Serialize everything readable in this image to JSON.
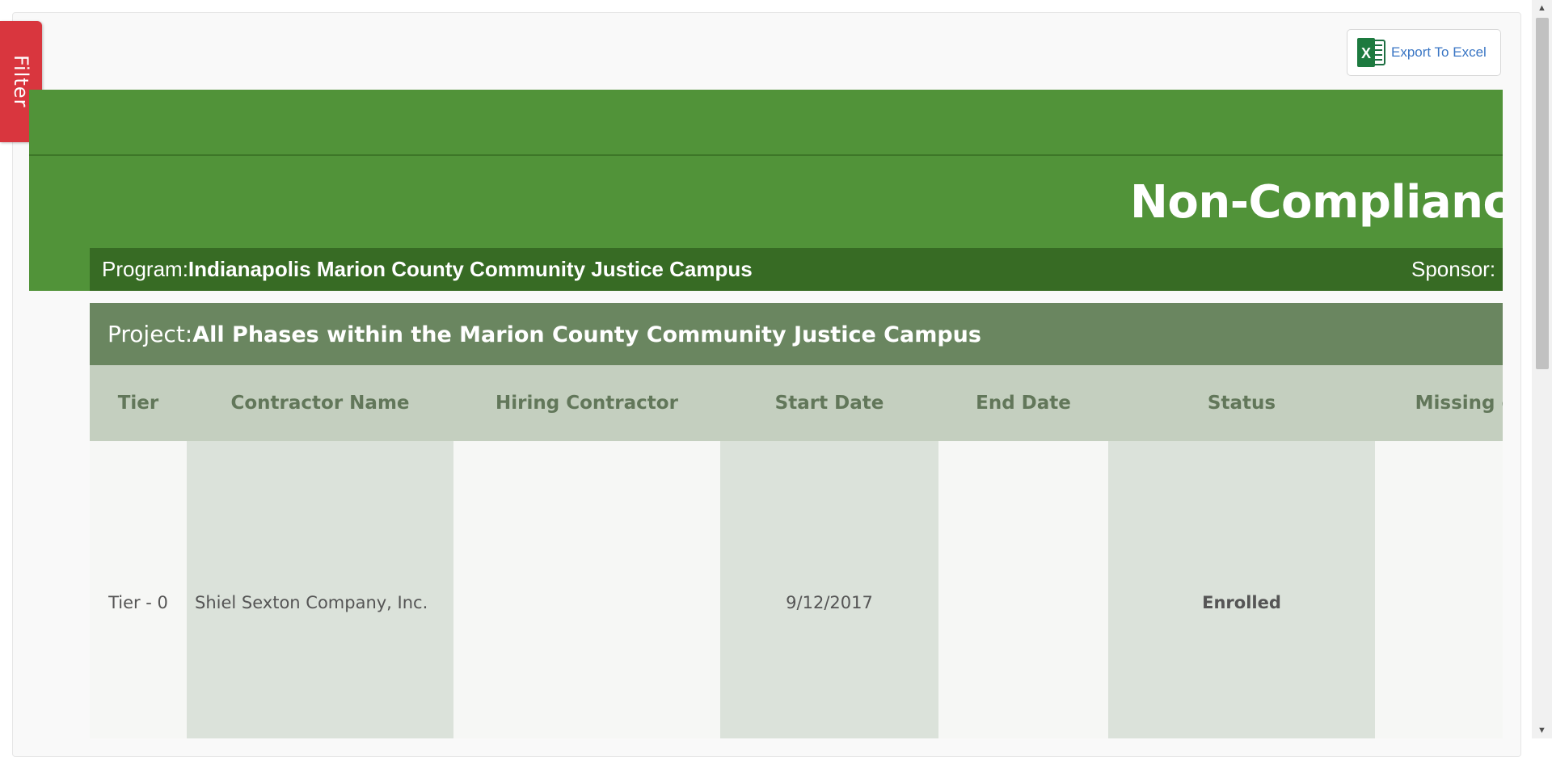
{
  "filter": {
    "label": "Filter"
  },
  "toolbar": {
    "export_label": "Export To Excel",
    "export_icon": "excel-icon"
  },
  "report": {
    "title": "Non-Compliance",
    "program_label": "Program:",
    "program_value": "Indianapolis Marion County Community Justice Campus",
    "sponsor_label": "Sponsor:",
    "project_label": "Project:",
    "project_value": "All Phases within the Marion County Community Justice Campus"
  },
  "table": {
    "headers": [
      "Tier",
      "Contractor Name",
      "Hiring Contractor",
      "Start Date",
      "End Date",
      "Status",
      "Missing or U"
    ],
    "rows": [
      {
        "tier": "Tier - 0",
        "contractor": "Shiel Sexton Company, Inc.",
        "hiring": "",
        "start": "9/12/2017",
        "end": "",
        "status": "Enrolled",
        "missing": ""
      }
    ]
  },
  "colors": {
    "header_green": "#519339",
    "program_bar": "#376b24",
    "project_bar": "#6a8660",
    "table_header": "#c4cfbf",
    "filter_red": "#d9363e",
    "link_blue": "#3a76c4"
  }
}
